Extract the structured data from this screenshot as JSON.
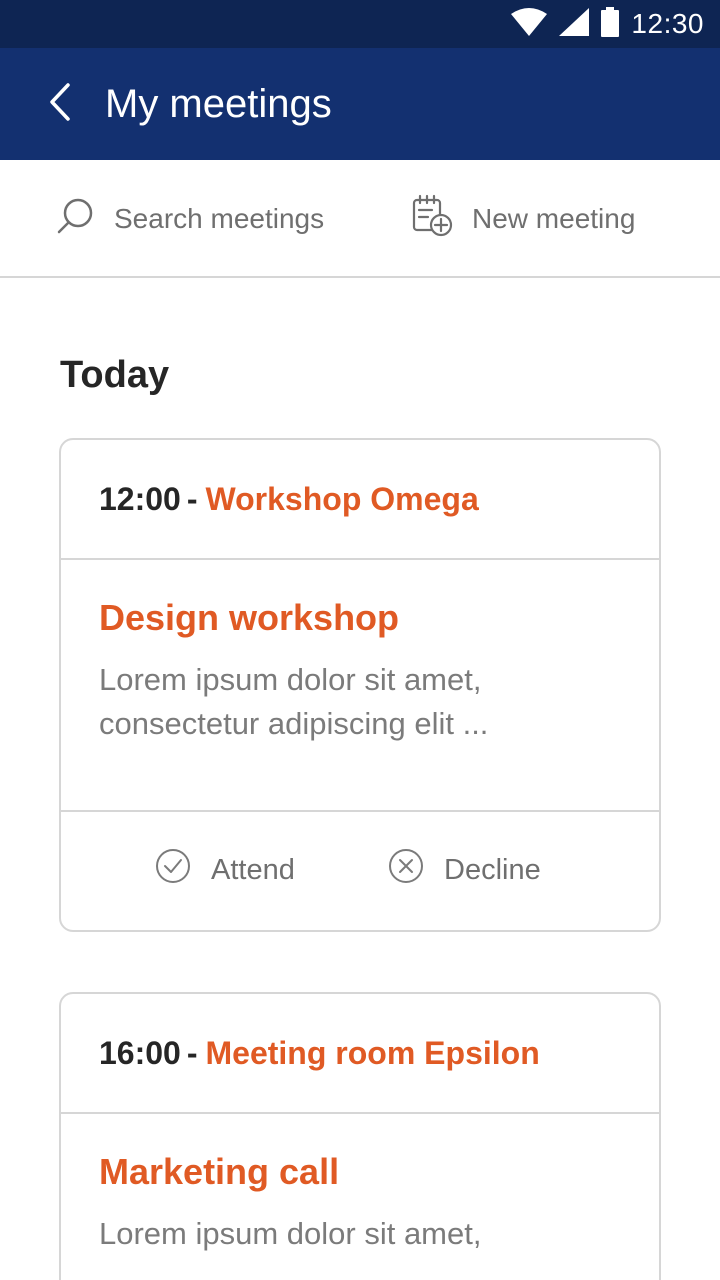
{
  "status_bar": {
    "time": "12:30",
    "icons": [
      "wifi-icon",
      "signal-icon",
      "battery-icon"
    ]
  },
  "app_bar": {
    "title": "My meetings",
    "back_icon": "back-chevron-icon"
  },
  "toolbar": {
    "search_label": "Search meetings",
    "new_meeting_label": "New meeting"
  },
  "section": {
    "title": "Today"
  },
  "meetings": [
    {
      "time": "12:00",
      "separator": "-",
      "room": "Workshop Omega",
      "title": "Design workshop",
      "description": "Lorem ipsum dolor sit amet, consectetur adipiscing elit ...",
      "attend_label": "Attend",
      "decline_label": "Decline"
    },
    {
      "time": "16:00",
      "separator": "-",
      "room": "Meeting room Epsilon",
      "title": "Marketing call",
      "description": "Lorem ipsum dolor sit amet,"
    }
  ],
  "colors": {
    "status_bar": "#0e2553",
    "app_bar": "#133070",
    "accent": "#e05a24",
    "text_dark": "#262626",
    "text_muted": "#7b7b7b",
    "border": "#d6d6d6"
  }
}
